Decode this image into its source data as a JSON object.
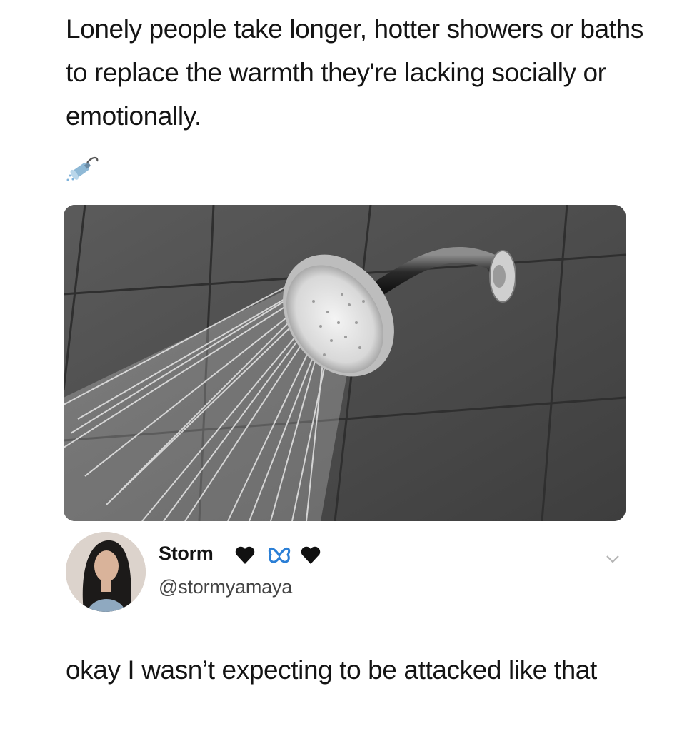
{
  "post": {
    "text": "Lonely people take longer, hotter showers or baths to replace the warmth they're lacking socially or emotionally.",
    "emoji": "shower-icon",
    "image": "shower-head-spraying-water-on-grey-tile-wall"
  },
  "reply": {
    "author": {
      "display_name": "Storm",
      "name_emojis": [
        "black-heart-icon",
        "blue-butterfly-icon",
        "black-heart-icon"
      ],
      "handle": "@stormyamaya"
    },
    "text": "okay I wasn’t expecting to be attacked like that",
    "menu_icon": "chevron-down-icon"
  },
  "colors": {
    "text": "#141414",
    "handle": "#444444",
    "tile": "#4a4a4a",
    "butterfly": "#2b7fd6"
  }
}
